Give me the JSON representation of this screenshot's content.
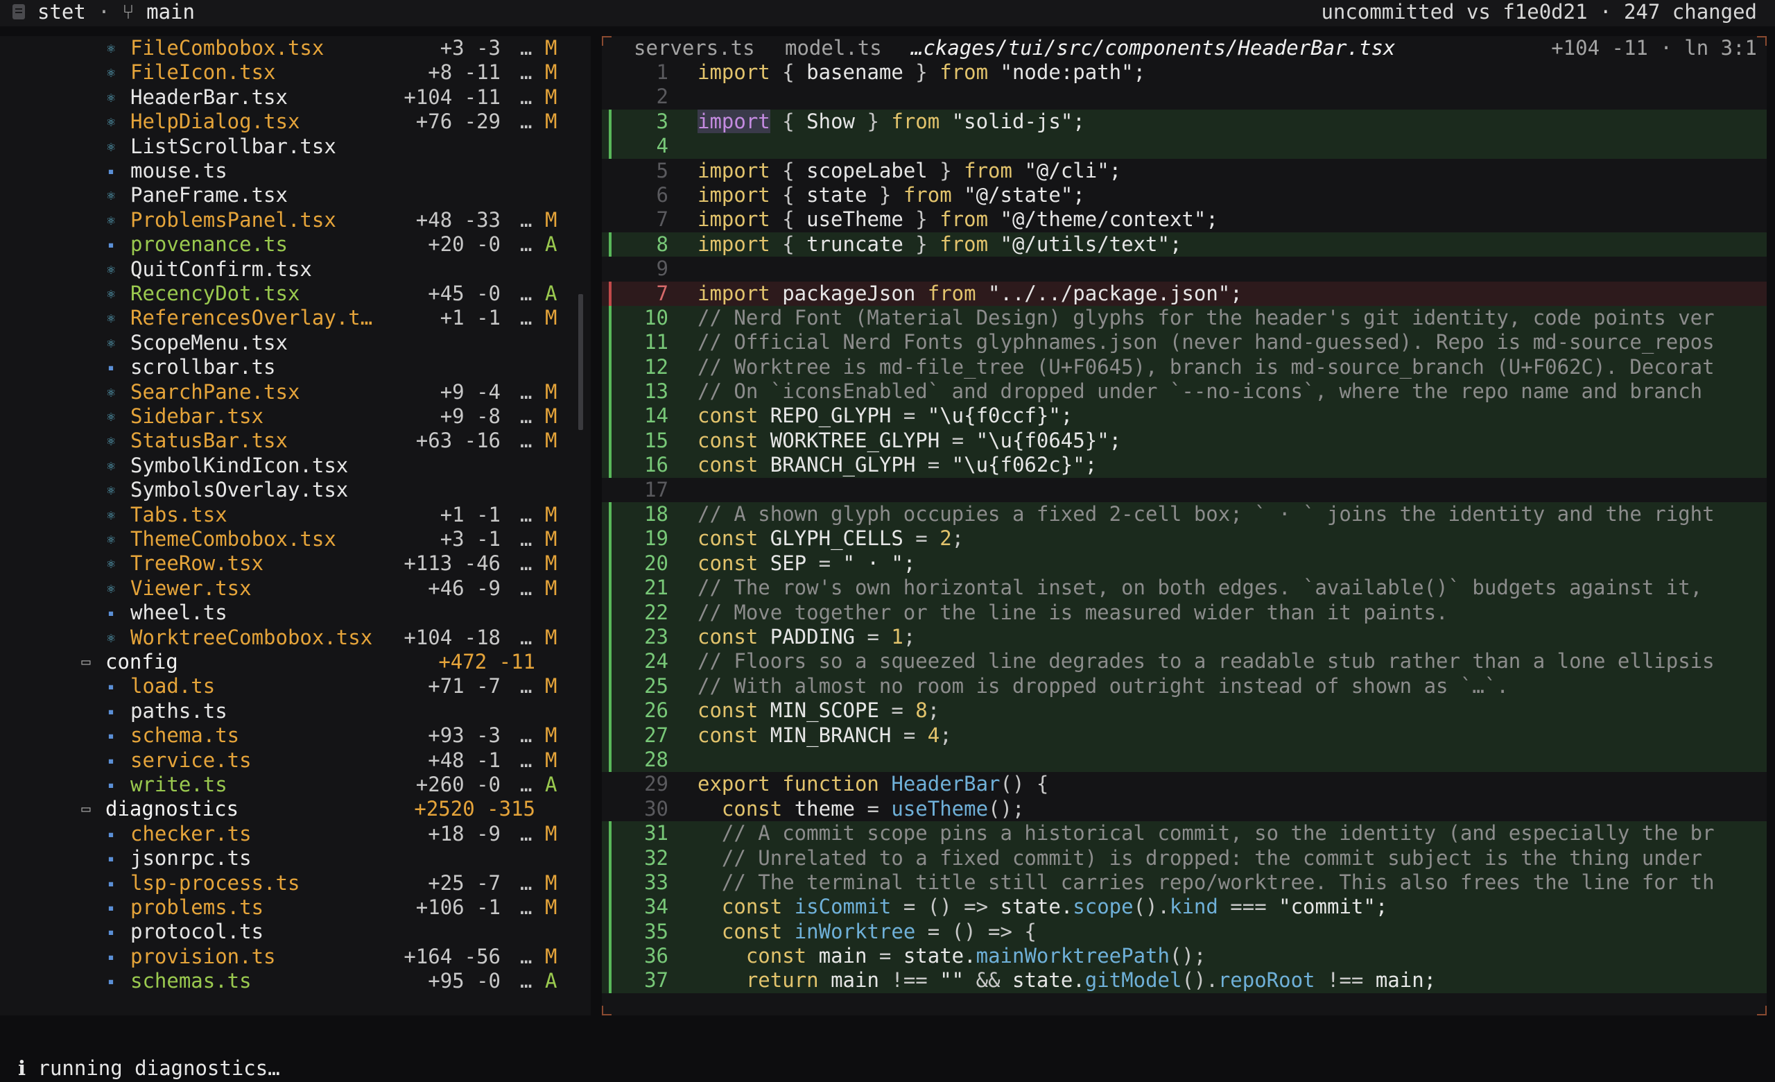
{
  "app": {
    "name": "stet",
    "branch": "main",
    "compare": "uncommitted vs f1e0d21 · 247 changed"
  },
  "sidebar": {
    "rows": [
      {
        "name": "FileCombobox.tsx",
        "icon": "react",
        "level": 3,
        "kind": "file",
        "stats": "+3 -3",
        "status": "M"
      },
      {
        "name": "FileIcon.tsx",
        "icon": "react",
        "level": 3,
        "kind": "file",
        "stats": "+8 -11",
        "status": "M"
      },
      {
        "name": "HeaderBar.tsx",
        "icon": "react",
        "level": 3,
        "kind": "file",
        "stats": "+104 -11",
        "status": "M",
        "selected": true
      },
      {
        "name": "HelpDialog.tsx",
        "icon": "react",
        "level": 3,
        "kind": "file",
        "stats": "+76 -29",
        "status": "M"
      },
      {
        "name": "ListScrollbar.tsx",
        "icon": "react",
        "level": 3,
        "kind": "file",
        "stats": "",
        "status": ""
      },
      {
        "name": "mouse.ts",
        "icon": "ts",
        "level": 3,
        "kind": "file",
        "stats": "",
        "status": ""
      },
      {
        "name": "PaneFrame.tsx",
        "icon": "react",
        "level": 3,
        "kind": "file",
        "stats": "",
        "status": ""
      },
      {
        "name": "ProblemsPanel.tsx",
        "icon": "react",
        "level": 3,
        "kind": "file",
        "stats": "+48 -33",
        "status": "M"
      },
      {
        "name": "provenance.ts",
        "icon": "ts",
        "level": 3,
        "kind": "file",
        "stats": "+20 -0",
        "status": "A"
      },
      {
        "name": "QuitConfirm.tsx",
        "icon": "react",
        "level": 3,
        "kind": "file",
        "stats": "",
        "status": ""
      },
      {
        "name": "RecencyDot.tsx",
        "icon": "react",
        "level": 3,
        "kind": "file",
        "stats": "+45 -0",
        "status": "A"
      },
      {
        "name": "ReferencesOverlay.t…",
        "icon": "react",
        "level": 3,
        "kind": "file",
        "stats": "+1 -1",
        "status": "M"
      },
      {
        "name": "ScopeMenu.tsx",
        "icon": "react",
        "level": 3,
        "kind": "file",
        "stats": "",
        "status": ""
      },
      {
        "name": "scrollbar.ts",
        "icon": "ts",
        "level": 3,
        "kind": "file",
        "stats": "",
        "status": ""
      },
      {
        "name": "SearchPane.tsx",
        "icon": "react",
        "level": 3,
        "kind": "file",
        "stats": "+9 -4",
        "status": "M"
      },
      {
        "name": "Sidebar.tsx",
        "icon": "react",
        "level": 3,
        "kind": "file",
        "stats": "+9 -8",
        "status": "M"
      },
      {
        "name": "StatusBar.tsx",
        "icon": "react",
        "level": 3,
        "kind": "file",
        "stats": "+63 -16",
        "status": "M"
      },
      {
        "name": "SymbolKindIcon.tsx",
        "icon": "react",
        "level": 3,
        "kind": "file",
        "stats": "",
        "status": ""
      },
      {
        "name": "SymbolsOverlay.tsx",
        "icon": "react",
        "level": 3,
        "kind": "file",
        "stats": "",
        "status": ""
      },
      {
        "name": "Tabs.tsx",
        "icon": "react",
        "level": 3,
        "kind": "file",
        "stats": "+1 -1",
        "status": "M"
      },
      {
        "name": "ThemeCombobox.tsx",
        "icon": "react",
        "level": 3,
        "kind": "file",
        "stats": "+3 -1",
        "status": "M"
      },
      {
        "name": "TreeRow.tsx",
        "icon": "react",
        "level": 3,
        "kind": "file",
        "stats": "+113 -46",
        "status": "M"
      },
      {
        "name": "Viewer.tsx",
        "icon": "react",
        "level": 3,
        "kind": "file",
        "stats": "+46 -9",
        "status": "M"
      },
      {
        "name": "wheel.ts",
        "icon": "ts",
        "level": 3,
        "kind": "file",
        "stats": "",
        "status": ""
      },
      {
        "name": "WorktreeCombobox.tsx",
        "icon": "react",
        "level": 3,
        "kind": "file",
        "stats": "+104 -18",
        "status": "M"
      },
      {
        "name": "config",
        "icon": "folder",
        "level": 2,
        "kind": "dir",
        "stats": "+472 -11",
        "status": ""
      },
      {
        "name": "load.ts",
        "icon": "ts",
        "level": 3,
        "kind": "file",
        "stats": "+71 -7",
        "status": "M"
      },
      {
        "name": "paths.ts",
        "icon": "ts",
        "level": 3,
        "kind": "file",
        "stats": "",
        "status": ""
      },
      {
        "name": "schema.ts",
        "icon": "ts",
        "level": 3,
        "kind": "file",
        "stats": "+93 -3",
        "status": "M"
      },
      {
        "name": "service.ts",
        "icon": "ts",
        "level": 3,
        "kind": "file",
        "stats": "+48 -1",
        "status": "M"
      },
      {
        "name": "write.ts",
        "icon": "ts",
        "level": 3,
        "kind": "file",
        "stats": "+260 -0",
        "status": "A"
      },
      {
        "name": "diagnostics",
        "icon": "folder",
        "level": 2,
        "kind": "dir",
        "stats": "+2520 -315",
        "status": ""
      },
      {
        "name": "checker.ts",
        "icon": "ts",
        "level": 3,
        "kind": "file",
        "stats": "+18 -9",
        "status": "M"
      },
      {
        "name": "jsonrpc.ts",
        "icon": "ts",
        "level": 3,
        "kind": "file",
        "stats": "",
        "status": ""
      },
      {
        "name": "lsp-process.ts",
        "icon": "ts",
        "level": 3,
        "kind": "file",
        "stats": "+25 -7",
        "status": "M"
      },
      {
        "name": "problems.ts",
        "icon": "ts",
        "level": 3,
        "kind": "file",
        "stats": "+106 -1",
        "status": "M"
      },
      {
        "name": "protocol.ts",
        "icon": "ts",
        "level": 3,
        "kind": "file",
        "stats": "",
        "status": ""
      },
      {
        "name": "provision.ts",
        "icon": "ts",
        "level": 3,
        "kind": "file",
        "stats": "+164 -56",
        "status": "M"
      },
      {
        "name": "schemas.ts",
        "icon": "ts",
        "level": 3,
        "kind": "file",
        "stats": "+95 -0",
        "status": "A"
      }
    ]
  },
  "viewer": {
    "tabs": [
      "servers.ts",
      "model.ts",
      "…ckages/tui/src/components/HeaderBar.tsx"
    ],
    "active_tab": 2,
    "info": "+104 -11 · ln 3:1",
    "lines": [
      {
        "n": "1",
        "t": "",
        "segs": [
          [
            "kw",
            "import "
          ],
          [
            "pu",
            "{ "
          ],
          [
            "str",
            "basename "
          ],
          [
            "pu",
            "} "
          ],
          [
            "kw",
            "from "
          ],
          [
            "str",
            "\"node:path\";"
          ]
        ]
      },
      {
        "n": "2",
        "t": "",
        "segs": []
      },
      {
        "n": "3",
        "t": "add",
        "segs": [
          [
            "hl",
            "import"
          ],
          [
            "pu",
            " { "
          ],
          [
            "str",
            "Show "
          ],
          [
            "pu",
            "} "
          ],
          [
            "kw",
            "from "
          ],
          [
            "str",
            "\"solid-js\";"
          ]
        ]
      },
      {
        "n": "4",
        "t": "add",
        "segs": []
      },
      {
        "n": "5",
        "t": "",
        "segs": [
          [
            "kw",
            "import "
          ],
          [
            "pu",
            "{ "
          ],
          [
            "str",
            "scopeLabel "
          ],
          [
            "pu",
            "} "
          ],
          [
            "kw",
            "from "
          ],
          [
            "str",
            "\"@/cli\";"
          ]
        ]
      },
      {
        "n": "6",
        "t": "",
        "segs": [
          [
            "kw",
            "import "
          ],
          [
            "pu",
            "{ "
          ],
          [
            "str",
            "state "
          ],
          [
            "pu",
            "} "
          ],
          [
            "kw",
            "from "
          ],
          [
            "str",
            "\"@/state\";"
          ]
        ]
      },
      {
        "n": "7",
        "t": "",
        "segs": [
          [
            "kw",
            "import "
          ],
          [
            "pu",
            "{ "
          ],
          [
            "str",
            "useTheme "
          ],
          [
            "pu",
            "} "
          ],
          [
            "kw",
            "from "
          ],
          [
            "str",
            "\"@/theme/context\";"
          ]
        ]
      },
      {
        "n": "8",
        "t": "add",
        "segs": [
          [
            "kw",
            "import "
          ],
          [
            "pu",
            "{ "
          ],
          [
            "str",
            "truncate "
          ],
          [
            "pu",
            "} "
          ],
          [
            "kw",
            "from "
          ],
          [
            "str",
            "\"@/utils/text\";"
          ]
        ]
      },
      {
        "n": "9",
        "t": "",
        "segs": []
      },
      {
        "n": "7",
        "t": "del",
        "segs": [
          [
            "kw",
            "import "
          ],
          [
            "str",
            "packageJson "
          ],
          [
            "kw",
            "from "
          ],
          [
            "str",
            "\"../../package.json\";"
          ]
        ]
      },
      {
        "n": "10",
        "t": "add",
        "segs": [
          [
            "cm",
            "// Nerd Font (Material Design) glyphs for the header's git identity, code points ver"
          ]
        ]
      },
      {
        "n": "11",
        "t": "add",
        "segs": [
          [
            "cm",
            "// Official Nerd Fonts glyphnames.json (never hand-guessed). Repo is md-source_repos"
          ]
        ]
      },
      {
        "n": "12",
        "t": "add",
        "segs": [
          [
            "cm",
            "// Worktree is md-file_tree (U+F0645), branch is md-source_branch (U+F062C). Decorat"
          ]
        ]
      },
      {
        "n": "13",
        "t": "add",
        "segs": [
          [
            "cm",
            "// On `iconsEnabled` and dropped under `--no-icons`, where the repo name and branch "
          ]
        ]
      },
      {
        "n": "14",
        "t": "add",
        "segs": [
          [
            "kw",
            "const "
          ],
          [
            "str",
            "REPO_GLYPH "
          ],
          [
            "pu",
            "= "
          ],
          [
            "str",
            "\"\\u{f0ccf}\";"
          ]
        ]
      },
      {
        "n": "15",
        "t": "add",
        "segs": [
          [
            "kw",
            "const "
          ],
          [
            "str",
            "WORKTREE_GLYPH "
          ],
          [
            "pu",
            "= "
          ],
          [
            "str",
            "\"\\u{f0645}\";"
          ]
        ]
      },
      {
        "n": "16",
        "t": "add",
        "segs": [
          [
            "kw",
            "const "
          ],
          [
            "str",
            "BRANCH_GLYPH "
          ],
          [
            "pu",
            "= "
          ],
          [
            "str",
            "\"\\u{f062c}\";"
          ]
        ]
      },
      {
        "n": "17",
        "t": "",
        "segs": []
      },
      {
        "n": "18",
        "t": "add",
        "segs": [
          [
            "cm",
            "// A shown glyph occupies a fixed 2-cell box; ` · ` joins the identity and the right"
          ]
        ]
      },
      {
        "n": "19",
        "t": "add",
        "segs": [
          [
            "kw",
            "const "
          ],
          [
            "str",
            "GLYPH_CELLS "
          ],
          [
            "pu",
            "= "
          ],
          [
            "kw",
            "2"
          ],
          [
            "pu",
            ";"
          ]
        ]
      },
      {
        "n": "20",
        "t": "add",
        "segs": [
          [
            "kw",
            "const "
          ],
          [
            "str",
            "SEP "
          ],
          [
            "pu",
            "= "
          ],
          [
            "str",
            "\" · \";"
          ]
        ]
      },
      {
        "n": "21",
        "t": "add",
        "segs": [
          [
            "cm",
            "// The row's own horizontal inset, on both edges. `available()` budgets against it, "
          ]
        ]
      },
      {
        "n": "22",
        "t": "add",
        "segs": [
          [
            "cm",
            "// Move together or the line is measured wider than it paints."
          ]
        ]
      },
      {
        "n": "23",
        "t": "add",
        "segs": [
          [
            "kw",
            "const "
          ],
          [
            "str",
            "PADDING "
          ],
          [
            "pu",
            "= "
          ],
          [
            "kw",
            "1"
          ],
          [
            "pu",
            ";"
          ]
        ]
      },
      {
        "n": "24",
        "t": "add",
        "segs": [
          [
            "cm",
            "// Floors so a squeezed line degrades to a readable stub rather than a lone ellipsis"
          ]
        ]
      },
      {
        "n": "25",
        "t": "add",
        "segs": [
          [
            "cm",
            "// With almost no room is dropped outright instead of shown as `…`."
          ]
        ]
      },
      {
        "n": "26",
        "t": "add",
        "segs": [
          [
            "kw",
            "const "
          ],
          [
            "str",
            "MIN_SCOPE "
          ],
          [
            "pu",
            "= "
          ],
          [
            "kw",
            "8"
          ],
          [
            "pu",
            ";"
          ]
        ]
      },
      {
        "n": "27",
        "t": "add",
        "segs": [
          [
            "kw",
            "const "
          ],
          [
            "str",
            "MIN_BRANCH "
          ],
          [
            "pu",
            "= "
          ],
          [
            "kw",
            "4"
          ],
          [
            "pu",
            ";"
          ]
        ]
      },
      {
        "n": "28",
        "t": "add",
        "segs": []
      },
      {
        "n": "29",
        "t": "",
        "segs": [
          [
            "kw",
            "export function "
          ],
          [
            "fn",
            "HeaderBar"
          ],
          [
            "pu",
            "() {"
          ]
        ]
      },
      {
        "n": "30",
        "t": "",
        "segs": [
          [
            "kw",
            "  const "
          ],
          [
            "str",
            "theme "
          ],
          [
            "pu",
            "= "
          ],
          [
            "fn",
            "useTheme"
          ],
          [
            "pu",
            "();"
          ]
        ]
      },
      {
        "n": "31",
        "t": "add",
        "segs": [
          [
            "cm",
            "  // A commit scope pins a historical commit, so the identity (and especially the br"
          ]
        ]
      },
      {
        "n": "32",
        "t": "add",
        "segs": [
          [
            "cm",
            "  // Unrelated to a fixed commit) is dropped: the commit subject is the thing under "
          ]
        ]
      },
      {
        "n": "33",
        "t": "add",
        "segs": [
          [
            "cm",
            "  // The terminal title still carries repo/worktree. This also frees the line for th"
          ]
        ]
      },
      {
        "n": "34",
        "t": "add",
        "segs": [
          [
            "kw",
            "  const "
          ],
          [
            "fn",
            "isCommit "
          ],
          [
            "pu",
            "= () => "
          ],
          [
            "str",
            "state."
          ],
          [
            "fn",
            "scope"
          ],
          [
            "pu",
            "()."
          ],
          [
            "fn",
            "kind "
          ],
          [
            "pu",
            "=== "
          ],
          [
            "str",
            "\"commit\";"
          ]
        ]
      },
      {
        "n": "35",
        "t": "add",
        "segs": [
          [
            "kw",
            "  const "
          ],
          [
            "fn",
            "inWorktree "
          ],
          [
            "pu",
            "= () => {"
          ]
        ]
      },
      {
        "n": "36",
        "t": "add",
        "segs": [
          [
            "kw",
            "    const "
          ],
          [
            "str",
            "main "
          ],
          [
            "pu",
            "= "
          ],
          [
            "str",
            "state."
          ],
          [
            "fn",
            "mainWorktreePath"
          ],
          [
            "pu",
            "();"
          ]
        ]
      },
      {
        "n": "37",
        "t": "add",
        "segs": [
          [
            "kw",
            "    return "
          ],
          [
            "str",
            "main "
          ],
          [
            "pu",
            "!== "
          ],
          [
            "str",
            "\"\" "
          ],
          [
            "pu",
            "&& "
          ],
          [
            "str",
            "state."
          ],
          [
            "fn",
            "gitModel"
          ],
          [
            "pu",
            "()."
          ],
          [
            "fn",
            "repoRoot "
          ],
          [
            "pu",
            "!== "
          ],
          [
            "str",
            "main;"
          ]
        ]
      }
    ]
  },
  "status": {
    "icon": "info-icon",
    "text": "running diagnostics…"
  },
  "colors": {
    "modified": "#e5a43a",
    "added": "#9ac94f",
    "add_bg": "#1b2a1d",
    "del_bg": "#2d1a1c"
  }
}
